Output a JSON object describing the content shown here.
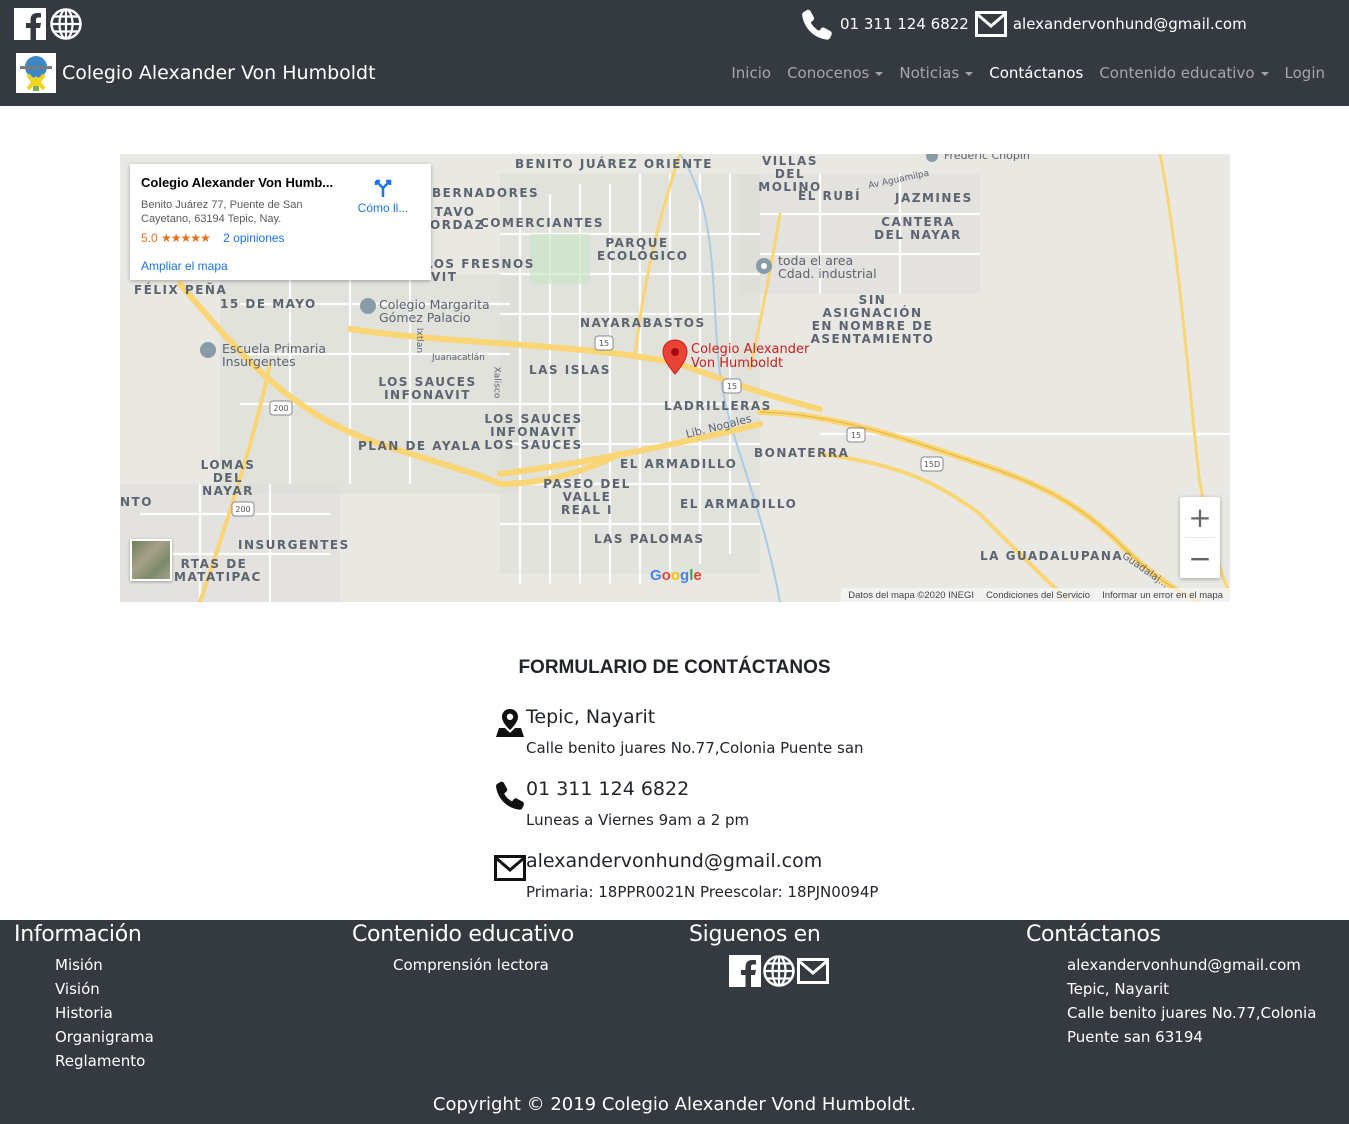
{
  "header": {
    "phone": "01 311 124 6822",
    "email": "alexandervonhund@gmail.com",
    "brand_name": "Colegio Alexander Von Humboldt",
    "social_icons": [
      "facebook-icon",
      "globe-icon"
    ],
    "nav": [
      {
        "label": "Inicio",
        "dropdown": false,
        "active": false
      },
      {
        "label": "Conocenos",
        "dropdown": true,
        "active": false
      },
      {
        "label": "Noticias",
        "dropdown": true,
        "active": false
      },
      {
        "label": "Contáctanos",
        "dropdown": false,
        "active": true
      },
      {
        "label": "Contenido educativo",
        "dropdown": true,
        "active": false
      },
      {
        "label": "Login",
        "dropdown": false,
        "active": false
      }
    ]
  },
  "map": {
    "info_title": "Colegio Alexander Von Humb...",
    "info_address": "Benito Juárez 77, Puente de San Cayetano, 63194 Tepic, Nay.",
    "rating_score": "5.0",
    "rating_stars": "★★★★★",
    "reviews": "2 opiniones",
    "enlarge_link": "Ampliar el mapa",
    "directions_label": "Cómo ll...",
    "marker_label": "Colegio Alexander\nVon Humboldt",
    "labels": [
      "Benito Juárez Oriente",
      "Villas del Molino",
      "El Rubí",
      "Jazmines",
      "Cantera del Nayar",
      "Bernadores",
      "Tavo Ordaz",
      "Comerciantes",
      "Parque Ecológico",
      "toda el area Cdad. industrial",
      "Félix Peña",
      "15 de Mayo",
      "Colegio Margarita Gómez Palacio",
      "Nayarabastos",
      "Sin asignación en nombre de asentamiento",
      "Escuela Primaria Insurgentes",
      "Los Sauces Infonavit",
      "Las Islas",
      "Ladrilleras",
      "Los Sauces Infonavit Los Sauces",
      "Plan de Ayala",
      "Lib. Nogales",
      "El Armadillo",
      "Bonaterra",
      "Lomas del Nayar",
      "Paseo del Valle Real I",
      "El Armadillo",
      "Insurgentes",
      "Las Palomas",
      "La Guadalupana",
      "Frederic Chopin",
      "Av Aguamilpa",
      "Juanacatlán",
      "Ixtlan",
      "Xalisco",
      "Guadalaj...",
      "rtas de Matatipac",
      "nto",
      "Los Fresnos",
      "Vit"
    ],
    "road_shields": [
      "15",
      "15",
      "200",
      "200",
      "15",
      "15D"
    ],
    "google_logo": "Google",
    "footer_items": [
      "Datos del mapa ©2020 INEGI",
      "Condiciones del Servicio",
      "Informar un error en el mapa"
    ],
    "zoom_in": "+",
    "zoom_out": "−"
  },
  "contact": {
    "title": "FORMULARIO DE CONTÁCTANOS",
    "location_main": "Tepic, Nayarit",
    "location_sub": "Calle benito juares No.77,Colonia Puente san",
    "phone_main": "01 311 124 6822",
    "phone_sub": "Luneas a Viernes 9am a 2 pm",
    "email_main": "alexandervonhund@gmail.com",
    "email_sub": "Primaria: 18PPR0021N Preescolar: 18PJN0094P"
  },
  "footer": {
    "info_title": "Información",
    "info_links": [
      "Misión",
      "Visión",
      "Historia",
      "Organigrama",
      "Reglamento"
    ],
    "edu_title": "Contenido educativo",
    "edu_links": [
      "Comprensión lectora"
    ],
    "follow_title": "Siguenos en",
    "follow_icons": [
      "facebook-icon",
      "globe-icon",
      "mail-icon"
    ],
    "contact_title": "Contáctanos",
    "contact_lines": [
      "alexandervonhund@gmail.com",
      "Tepic, Nayarit",
      "Calle benito juares No.77,Colonia",
      "Puente san 63194"
    ],
    "copyright": "Copyright © 2019 Colegio Alexander Vond Humboldt."
  },
  "colors": {
    "header_bg": "#343a40",
    "map_bg": "#e9e8e3",
    "road_yellow": "#f9d574",
    "marker_red": "#ea4335"
  }
}
